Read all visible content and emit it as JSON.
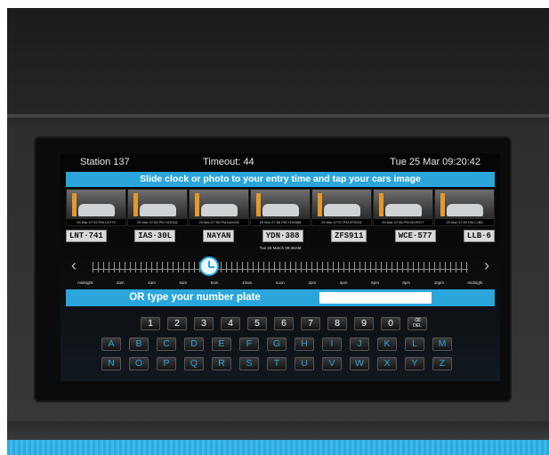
{
  "header": {
    "station": "Station 137",
    "timeout": "Timeout: 44",
    "datetime": "Tue 25 Mar 09:20:42"
  },
  "banner": "Slide clock or photo to your entry time and tap your cars image",
  "photos": [
    {
      "caption": "25 Mar 07:53 PM LNT70"
    },
    {
      "caption": "25 Mar 07:54 PM YAS30L"
    },
    {
      "caption": "25 Mar 07:55 PM NAYAN"
    },
    {
      "caption": "25 Mar 07:56 PM YDN388"
    },
    {
      "caption": "25 Mar 07:57 PM ZFS911"
    },
    {
      "caption": "25 Mar 07:58 PM WCE577"
    },
    {
      "caption": "25 Mar 07:59 PM LLB6"
    }
  ],
  "plates": [
    "LNT·741",
    "IAS·30L",
    "NAYAN",
    "YDN·388",
    "ZFS911",
    "WCE·577",
    "LLB·6"
  ],
  "timeline": {
    "date_label": "Tue 25 March 09:46AM",
    "hours": [
      "midnight",
      "2am",
      "4am",
      "6am",
      "8am",
      "10am",
      "noon",
      "2pm",
      "4pm",
      "6pm",
      "8pm",
      "10pm",
      "midnight"
    ],
    "position": 0.31
  },
  "entry": {
    "label": "OR type your number plate",
    "value": ""
  },
  "keyboard": {
    "numbers": [
      "1",
      "2",
      "3",
      "4",
      "5",
      "6",
      "7",
      "8",
      "9",
      "0"
    ],
    "del_label": "DEL",
    "row1": [
      "A",
      "B",
      "C",
      "D",
      "E",
      "F",
      "G",
      "H",
      "I",
      "J",
      "K",
      "L",
      "M"
    ],
    "row2": [
      "N",
      "O",
      "P",
      "Q",
      "R",
      "S",
      "T",
      "U",
      "V",
      "W",
      "X",
      "Y",
      "Z"
    ]
  },
  "colors": {
    "accent": "#2aa6dc",
    "letter_keys": "#2aa6dc"
  },
  "icons": [
    "backspace-icon",
    "clock-icon",
    "chevron-left-icon",
    "chevron-right-icon"
  ]
}
